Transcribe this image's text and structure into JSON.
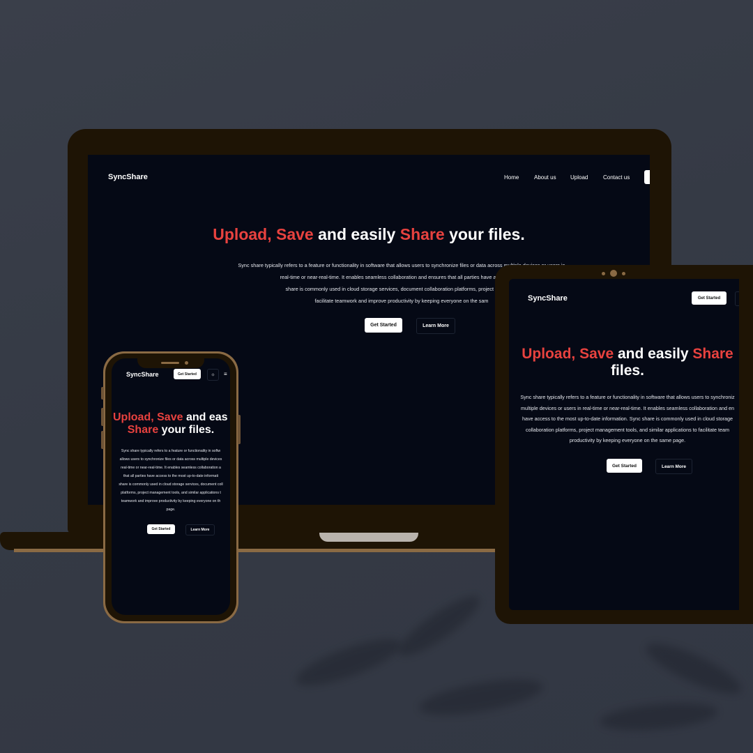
{
  "brand": "SyncShare",
  "nav": [
    "Home",
    "About us",
    "Upload",
    "Contact us"
  ],
  "hero": {
    "h1": "Upload,",
    "h2": "Save",
    "mid": "and easily",
    "h3": "Share",
    "tail1": "your",
    "tail2": "files."
  },
  "description": {
    "laptop": [
      "Sync share typically refers to a feature or functionality in software that allows users to synchronize files or data across multiple devices or users in",
      "real-time or near-real-time. It enables seamless collaboration and ensures that all parties have access to the",
      "share is commonly used in cloud storage services, document collaboration platforms, project managem",
      "facilitate teamwork and improve productivity by keeping everyone on the sam"
    ],
    "tablet": [
      "Sync share typically refers to a feature or functionality in software that allows users to synchroniz",
      "multiple devices or users in real-time or near-real-time. It enables seamless collaboration and en",
      "have access to the most up-to-date information. Sync share is commonly used in cloud storage",
      "collaboration platforms, project management tools, and similar applications to facilitate team",
      "productivity by keeping everyone on the same page."
    ],
    "phone": [
      "Sync share typically refers to a feature or functionality in softw",
      "allows users to synchronize files or data across multiple devices",
      "real-time or near-real-time. It enables seamless collaboration a",
      "that all parties have access to the most up-to-date informati",
      "share is commonly used in cloud storage services, document coll",
      "platforms, project management tools, and similar applications t",
      "teamwork and improve productivity by keeping everyone on th",
      "page."
    ]
  },
  "buttons": {
    "get_started": "Get Started",
    "learn_more": "Learn More"
  },
  "phone_hero": {
    "line1a": "Upload,",
    "line1b": "Save",
    "line1c": "and eas",
    "line2a": "Share",
    "line2b": "your files."
  },
  "tablet_hero": {
    "line1a": "Upload,",
    "line1b": "Save",
    "line1c": "and easily",
    "line1d": "Share",
    "line2": "files."
  },
  "icons": {
    "theme_toggle": "sun-icon",
    "menu": "hamburger-menu-icon"
  },
  "colors": {
    "accent": "#e8423f",
    "screen_bg": "#050915",
    "device_frame": "#1e1405",
    "device_trim": "#8a6a44",
    "backdrop": "#353a45"
  }
}
